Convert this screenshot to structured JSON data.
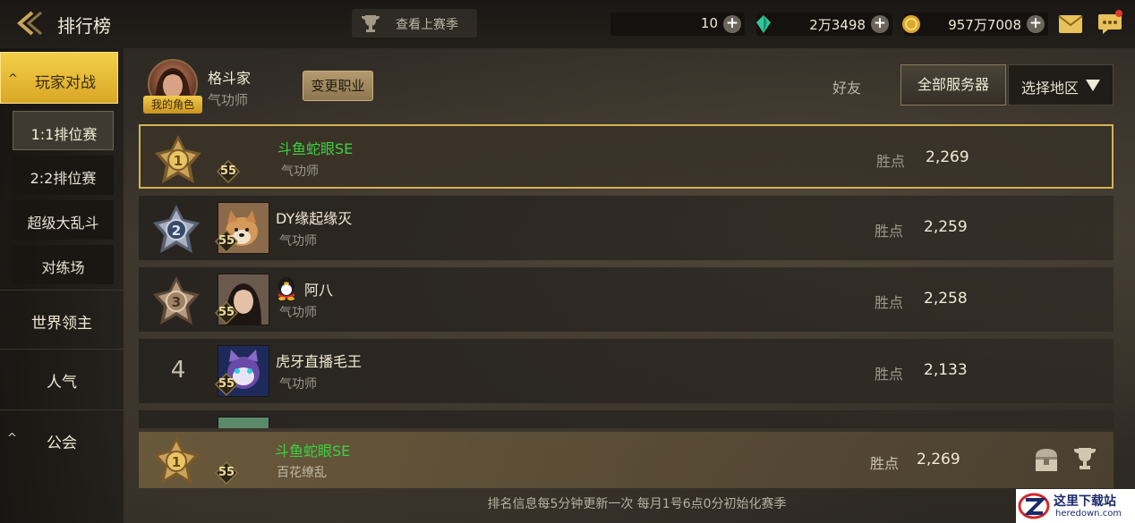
{
  "header": {
    "title": "排行榜",
    "season_button": "查看上赛季",
    "currencies": [
      {
        "icon": "crescent-currency-icon",
        "value": "10"
      },
      {
        "icon": "green-gem-icon",
        "value": "2万3498"
      },
      {
        "icon": "gold-coin-icon",
        "value": "957万7008"
      }
    ],
    "plus": "+"
  },
  "sidebar": {
    "main": "玩家对战",
    "subs": [
      "1:1排位赛",
      "2:2排位赛",
      "超级大乱斗",
      "对练场"
    ],
    "active_sub": 0,
    "categories": [
      "世界领主",
      "人气",
      "公会"
    ]
  },
  "profile": {
    "name": "格斗家",
    "class": "气功师",
    "badge": "我的角色",
    "change_button": "变更职业"
  },
  "filters": {
    "friends": "好友",
    "all_servers": "全部服务器",
    "region": "选择地区"
  },
  "ranking": {
    "points_label": "胜点",
    "rows": [
      {
        "rank": "1",
        "level": "55",
        "name": "斗鱼蛇眼SE",
        "class": "气功师",
        "points": "2,269"
      },
      {
        "rank": "2",
        "level": "55",
        "name": "DY缘起缘灭",
        "class": "气功师",
        "points": "2,259"
      },
      {
        "rank": "3",
        "level": "55",
        "name": "阿八",
        "class": "气功师",
        "points": "2,258"
      },
      {
        "rank": "4",
        "level": "55",
        "name": "虎牙直播毛王",
        "class": "气功师",
        "points": "2,133"
      }
    ]
  },
  "my_rank": {
    "rank": "1",
    "level": "55",
    "name": "斗鱼蛇眼SE",
    "class": "百花缭乱",
    "points_label": "胜点",
    "points": "2,269"
  },
  "footer": "排名信息每5分钟更新一次 每月1号6点0分初始化赛季",
  "watermark": {
    "line1": "这里下载站",
    "line2": "heredown.com"
  }
}
